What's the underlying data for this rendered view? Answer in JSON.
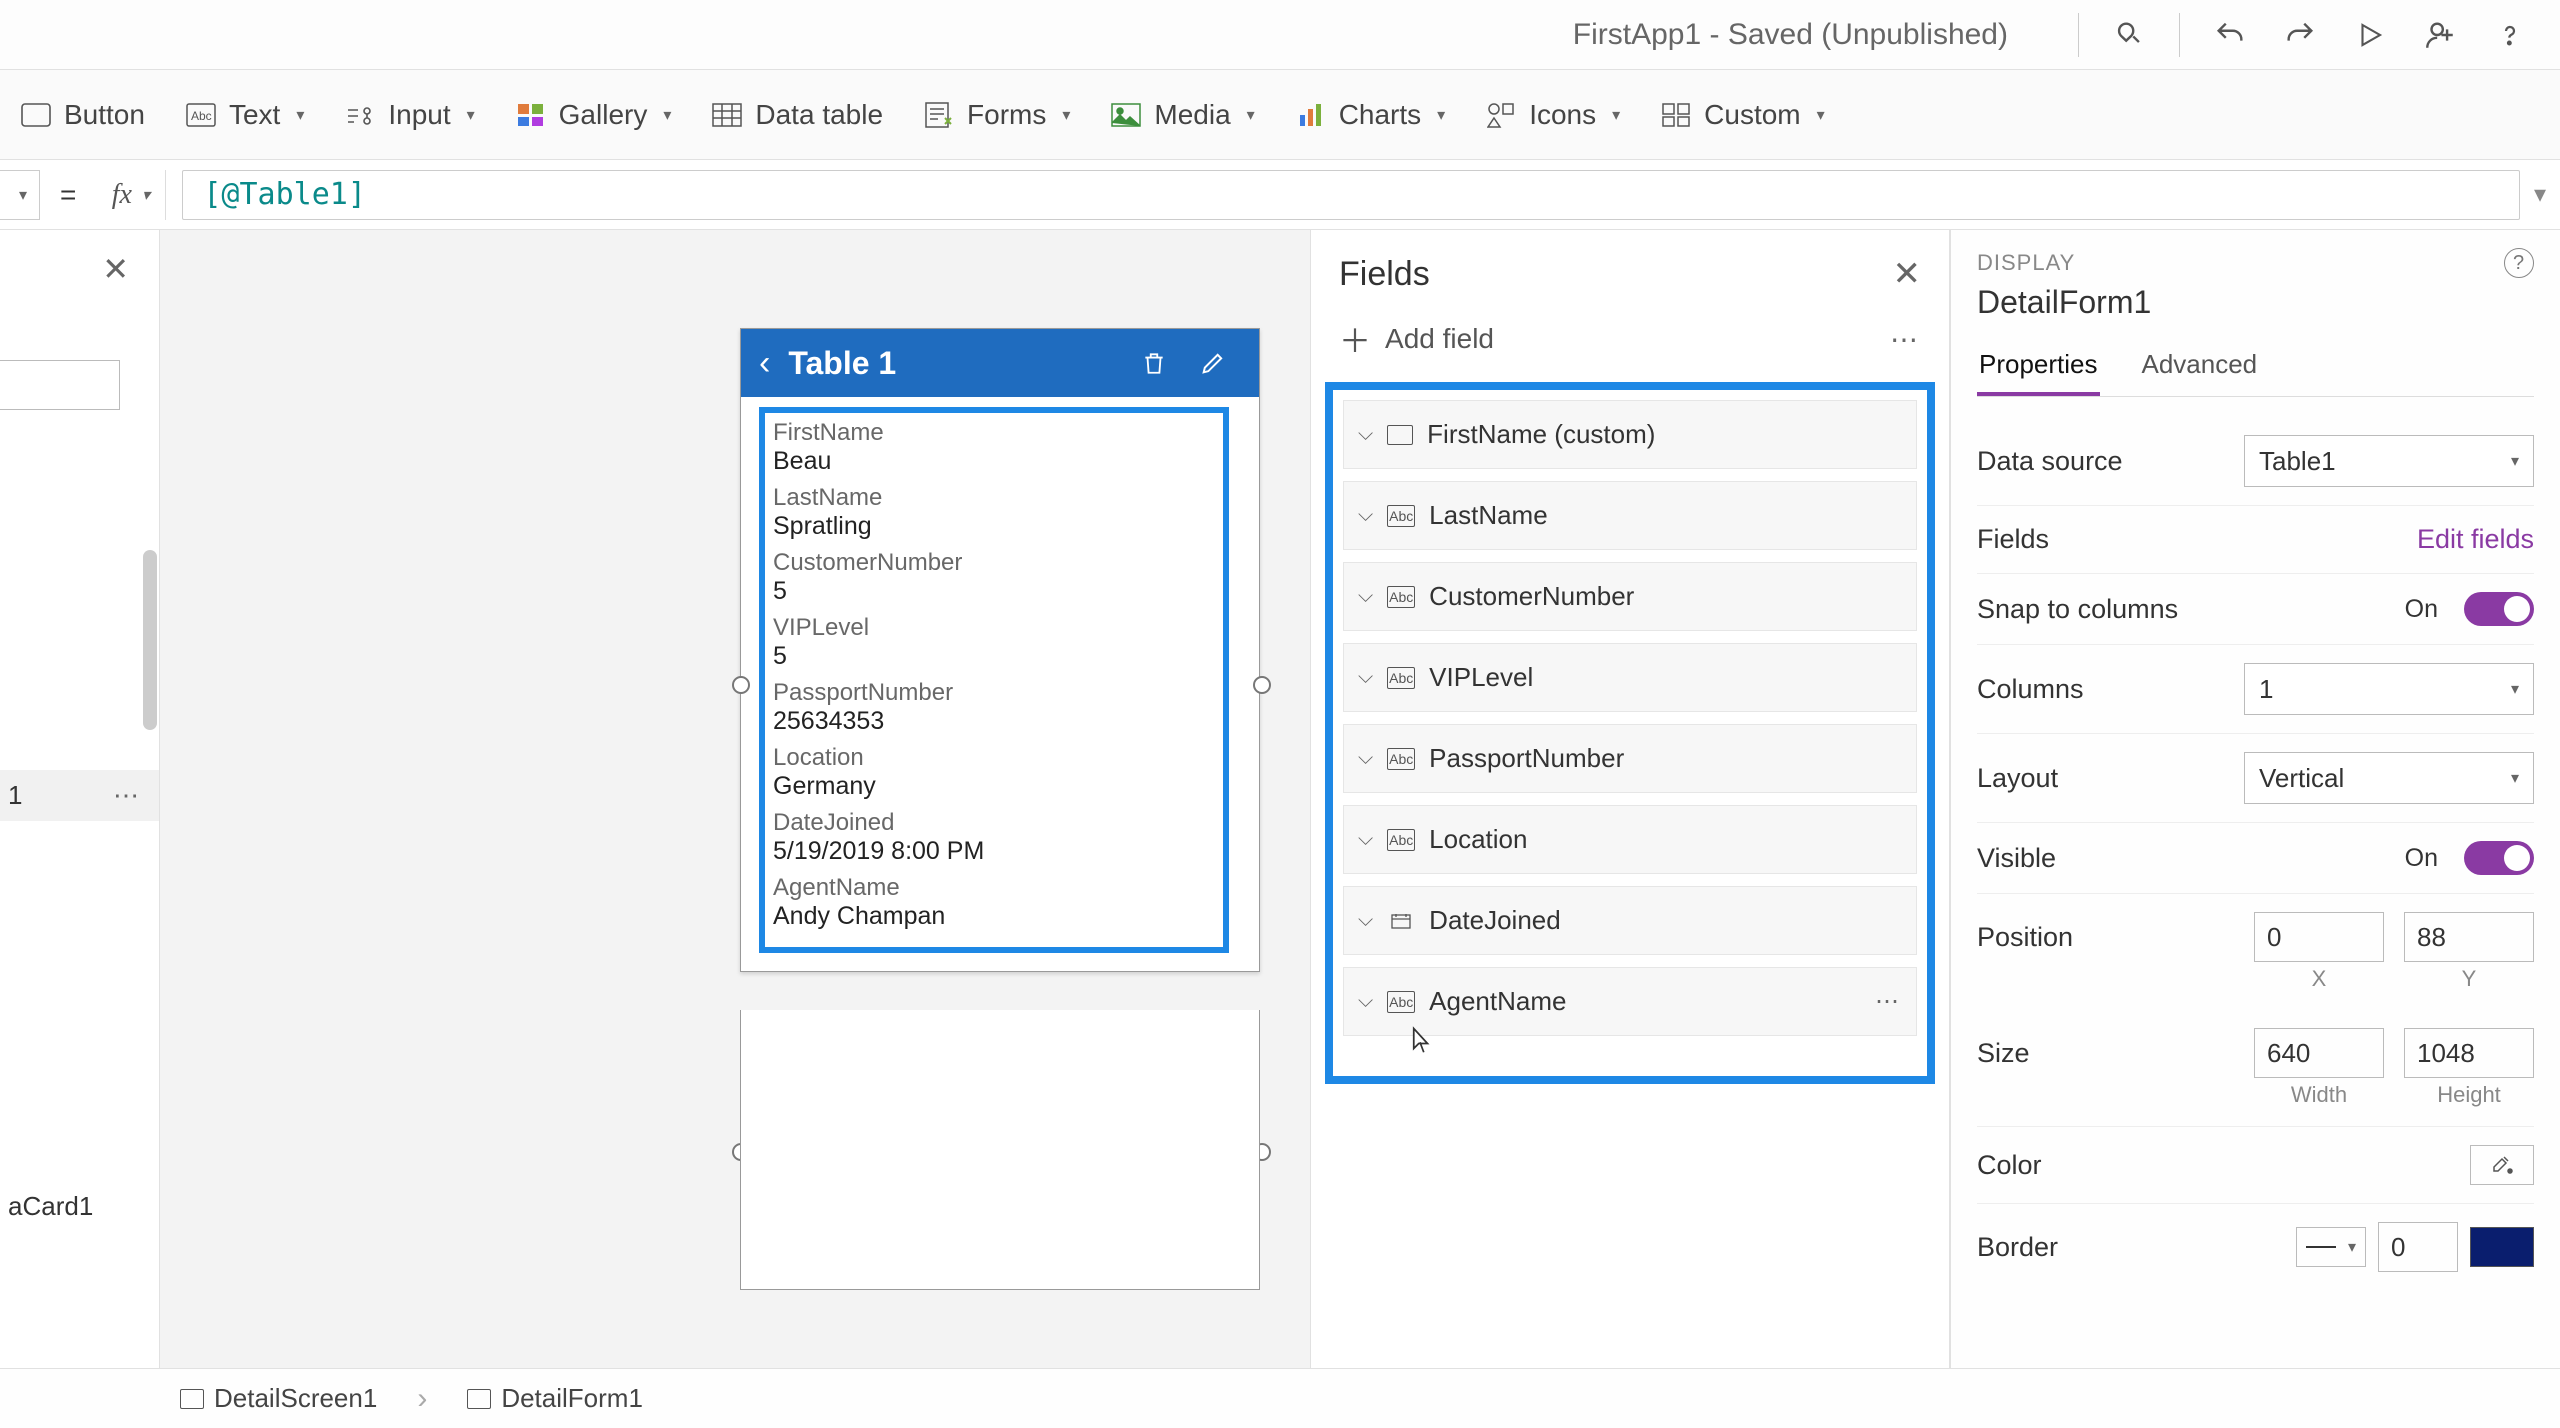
{
  "titlebar": {
    "title": "FirstApp1 - Saved (Unpublished)"
  },
  "ribbon": {
    "button": "Button",
    "text": "Text",
    "input": "Input",
    "gallery": "Gallery",
    "datatable": "Data table",
    "forms": "Forms",
    "media": "Media",
    "charts": "Charts",
    "icons": "Icons",
    "custom": "Custom"
  },
  "formula": {
    "value": "[@Table1]"
  },
  "canvasForm": {
    "title": "Table 1",
    "fields": [
      {
        "label": "FirstName",
        "value": "Beau"
      },
      {
        "label": "LastName",
        "value": "Spratling"
      },
      {
        "label": "CustomerNumber",
        "value": "5"
      },
      {
        "label": "VIPLevel",
        "value": "5"
      },
      {
        "label": "PassportNumber",
        "value": "25634353"
      },
      {
        "label": "Location",
        "value": "Germany"
      },
      {
        "label": "DateJoined",
        "value": "5/19/2019 8:00 PM"
      },
      {
        "label": "AgentName",
        "value": "Andy Champan"
      }
    ]
  },
  "fieldsPane": {
    "title": "Fields",
    "addField": "Add field",
    "items": [
      {
        "label": "FirstName (custom)",
        "icon": "blank"
      },
      {
        "label": "LastName",
        "icon": "abc"
      },
      {
        "label": "CustomerNumber",
        "icon": "abc"
      },
      {
        "label": "VIPLevel",
        "icon": "abc"
      },
      {
        "label": "PassportNumber",
        "icon": "abc"
      },
      {
        "label": "Location",
        "icon": "abc"
      },
      {
        "label": "DateJoined",
        "icon": "date"
      },
      {
        "label": "AgentName",
        "icon": "abc",
        "showDots": true
      }
    ]
  },
  "props": {
    "sectionLabel": "DISPLAY",
    "entityName": "DetailForm1",
    "tabs": {
      "properties": "Properties",
      "advanced": "Advanced"
    },
    "dataSourceLabel": "Data source",
    "dataSourceValue": "Table1",
    "fieldsLabel": "Fields",
    "editFields": "Edit fields",
    "snapLabel": "Snap to columns",
    "snapValue": "On",
    "columnsLabel": "Columns",
    "columnsValue": "1",
    "layoutLabel": "Layout",
    "layoutValue": "Vertical",
    "visibleLabel": "Visible",
    "visibleValue": "On",
    "positionLabel": "Position",
    "posX": "0",
    "posY": "88",
    "xLabel": "X",
    "yLabel": "Y",
    "sizeLabel": "Size",
    "width": "640",
    "height": "1048",
    "wLabel": "Width",
    "hLabel": "Height",
    "colorLabel": "Color",
    "borderLabel": "Border",
    "borderWidth": "0"
  },
  "tree": {
    "selectedItem": "1",
    "cardItem": "aCard1"
  },
  "breadcrumb": {
    "screen": "DetailScreen1",
    "form": "DetailForm1"
  }
}
